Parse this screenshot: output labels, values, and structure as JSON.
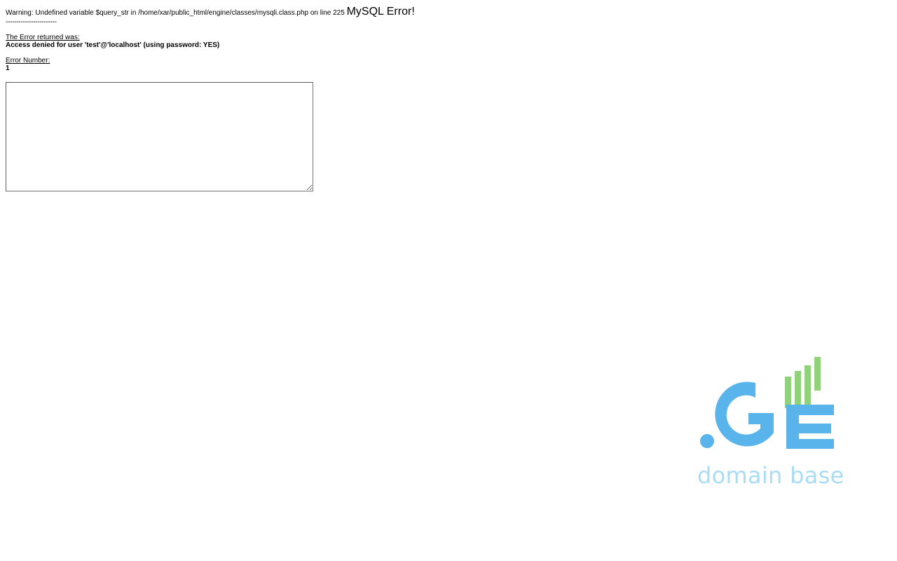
{
  "warning": {
    "text": "Warning: Undefined variable $query_str in /home/xar/public_html/engine/classes/mysqli.class.php on line 225",
    "title": "MySQL Error!"
  },
  "separator": "------------------------",
  "error_returned": {
    "label": "The Error returned was:",
    "message": "Access denied for user 'test'@'localhost' (using password: YES)"
  },
  "error_number": {
    "label": "Error Number:",
    "value": "1"
  },
  "query_box": {
    "value": ""
  },
  "logo": {
    "icon": "ge-domain-base-logo-icon",
    "text": "domain base",
    "colors": {
      "blue": "#59b4ec",
      "green": "#8fd27a",
      "light_blue": "#a9dcf5"
    }
  }
}
